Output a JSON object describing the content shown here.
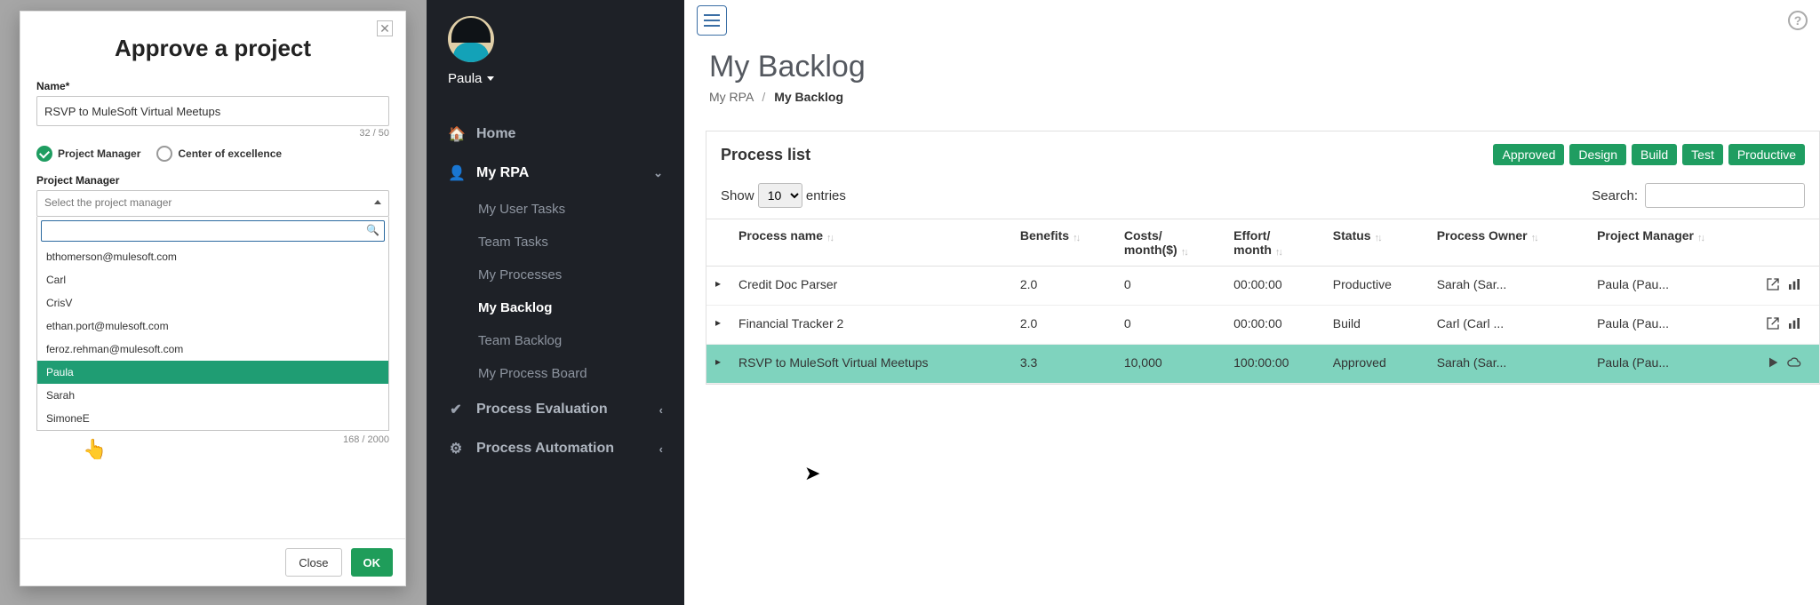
{
  "modal": {
    "title": "Approve a project",
    "name_label": "Name*",
    "name_value": "RSVP to MuleSoft Virtual Meetups",
    "name_counter": "32 / 50",
    "option_pm": "Project Manager",
    "option_coe": "Center of excellence",
    "pm_label": "Project Manager",
    "pm_placeholder": "Select the project manager",
    "dropdown": [
      "bthomerson@mulesoft.com",
      "Carl",
      "CrisV",
      "ethan.port@mulesoft.com",
      "feroz.rehman@mulesoft.com",
      "Paula",
      "Sarah",
      "SimoneE"
    ],
    "highlight_index": 5,
    "desc_counter": "168 / 2000",
    "close_btn": "Close",
    "ok_btn": "OK"
  },
  "sidebar": {
    "user_name": "Paula",
    "items": [
      {
        "icon": "home",
        "label": "Home",
        "type": "top"
      },
      {
        "icon": "user",
        "label": "My RPA",
        "type": "expanded"
      },
      {
        "label": "My User Tasks",
        "type": "sub"
      },
      {
        "label": "Team Tasks",
        "type": "sub"
      },
      {
        "label": "My Processes",
        "type": "sub"
      },
      {
        "label": "My Backlog",
        "type": "sub",
        "active": true
      },
      {
        "label": "Team Backlog",
        "type": "sub"
      },
      {
        "label": "My Process Board",
        "type": "sub"
      },
      {
        "icon": "check",
        "label": "Process Evaluation",
        "type": "top",
        "collapsed": true
      },
      {
        "icon": "branch",
        "label": "Process Automation",
        "type": "top",
        "collapsed": true
      }
    ]
  },
  "page": {
    "title": "My Backlog",
    "crumb_root": "My RPA",
    "crumb_current": "My Backlog"
  },
  "panel": {
    "title": "Process list",
    "badges": [
      "Approved",
      "Design",
      "Build",
      "Test",
      "Productive"
    ],
    "show_label_pre": "Show",
    "show_value": "10",
    "show_label_post": "entries",
    "search_label": "Search:",
    "columns": [
      "Process name",
      "Benefits",
      "Costs/ month($)",
      "Effort/ month",
      "Status",
      "Process Owner",
      "Project Manager"
    ],
    "rows": [
      {
        "name": "Credit Doc Parser",
        "benefits": "2.0",
        "costs": "0",
        "effort": "00:00:00",
        "status": "Productive",
        "owner": "Sarah (Sar...",
        "pm": "Paula (Pau...",
        "hl": false,
        "iconset": "a"
      },
      {
        "name": "Financial Tracker 2",
        "benefits": "2.0",
        "costs": "0",
        "effort": "00:00:00",
        "status": "Build",
        "owner": "Carl (Carl ...",
        "pm": "Paula (Pau...",
        "hl": false,
        "iconset": "a"
      },
      {
        "name": "RSVP to MuleSoft Virtual Meetups",
        "benefits": "3.3",
        "costs": "10,000",
        "effort": "100:00:00",
        "status": "Approved",
        "owner": "Sarah (Sar...",
        "pm": "Paula (Pau...",
        "hl": true,
        "iconset": "b"
      }
    ]
  }
}
